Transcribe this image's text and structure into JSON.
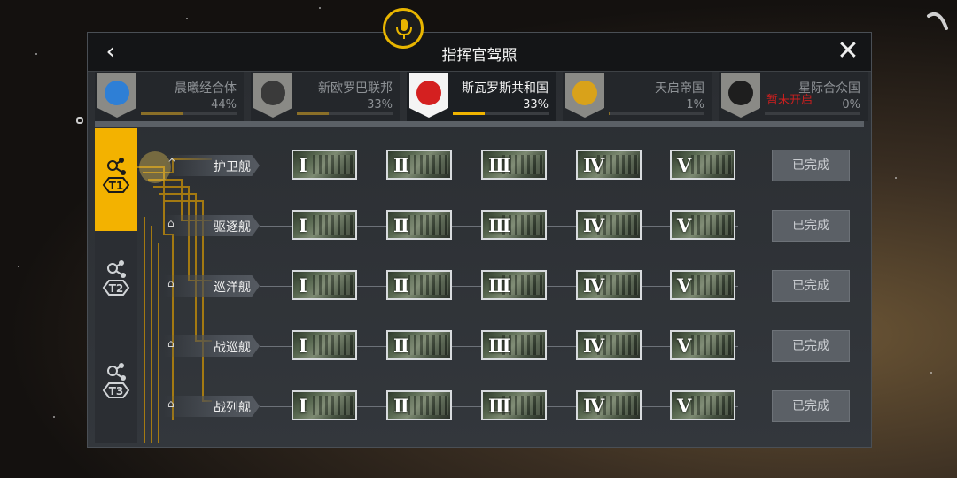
{
  "header": {
    "title": "指挥官驾照",
    "back_label": "‹",
    "close_label": "✕"
  },
  "factions": [
    {
      "name": "晨曦经合体",
      "percent": "44%",
      "progress": 0.44,
      "color": "#2e7fd6",
      "icon": "dawn-union-emblem-icon",
      "active": false,
      "locked_text": ""
    },
    {
      "name": "新欧罗巴联邦",
      "percent": "33%",
      "progress": 0.33,
      "color": "#3a3a3a",
      "icon": "cross-emblem-icon",
      "active": false,
      "locked_text": ""
    },
    {
      "name": "斯瓦罗斯共和国",
      "percent": "33%",
      "progress": 0.33,
      "color": "#d42020",
      "icon": "red-star-emblem-icon",
      "active": true,
      "locked_text": ""
    },
    {
      "name": "天启帝国",
      "percent": "1%",
      "progress": 0.01,
      "color": "#d9a21a",
      "icon": "apocalypse-emblem-icon",
      "active": false,
      "locked_text": ""
    },
    {
      "name": "星际合众国",
      "percent": "0%",
      "progress": 0.0,
      "color": "#1e1e1e",
      "icon": "hex-cube-emblem-icon",
      "active": false,
      "locked_text": "暂未开启"
    }
  ],
  "tiers": [
    {
      "label": "T1",
      "active": true
    },
    {
      "label": "T2",
      "active": false
    },
    {
      "label": "T3",
      "active": false
    }
  ],
  "ship_classes": [
    {
      "name": "护卫舰",
      "expand_icon": "^",
      "status": "已完成"
    },
    {
      "name": "驱逐舰",
      "expand_icon": "⌂",
      "status": "已完成"
    },
    {
      "name": "巡洋舰",
      "expand_icon": "⌂",
      "status": "已完成"
    },
    {
      "name": "战巡舰",
      "expand_icon": "⌂",
      "status": "已完成"
    },
    {
      "name": "战列舰",
      "expand_icon": "⌂",
      "status": "已完成"
    }
  ],
  "levels": [
    "I",
    "II",
    "III",
    "IV",
    "V"
  ],
  "colors": {
    "accent": "#f3b200",
    "panel": "#33373c",
    "locked": "#cc1f1f"
  }
}
